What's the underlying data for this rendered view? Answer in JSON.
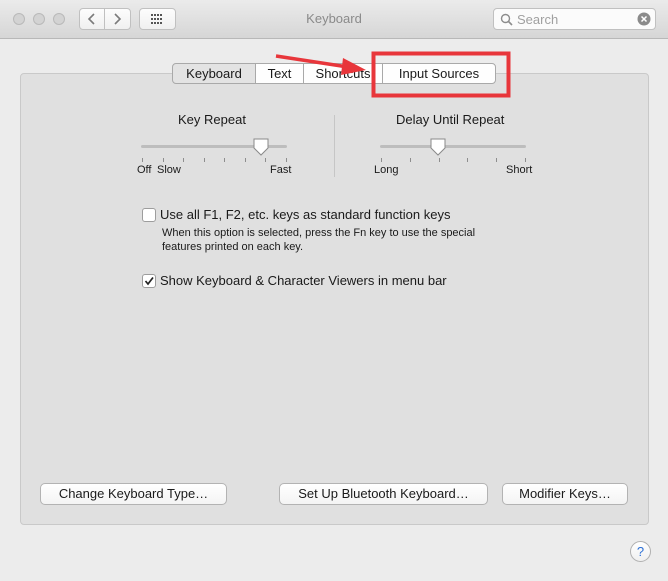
{
  "window": {
    "title": "Keyboard"
  },
  "toolbar": {
    "back": "‹",
    "forward": "›",
    "search_placeholder": "Search"
  },
  "tabs": [
    {
      "label": "Keyboard",
      "selected": true
    },
    {
      "label": "Text",
      "selected": false
    },
    {
      "label": "Shortcuts",
      "selected": false
    },
    {
      "label": "Input Sources",
      "selected": false
    }
  ],
  "sliders": {
    "key_repeat": {
      "title": "Key Repeat",
      "min_label": "Off",
      "low_label": "Slow",
      "high_label": "Fast",
      "value": 0.82
    },
    "delay": {
      "title": "Delay Until Repeat",
      "low_label": "Long",
      "high_label": "Short",
      "value": 0.4
    }
  },
  "options": {
    "fn_keys": {
      "label": "Use all F1, F2, etc. keys as standard function keys",
      "checked": false,
      "desc_line1": "When this option is selected, press the Fn key to use the special",
      "desc_line2": "features printed on each key."
    },
    "viewers": {
      "label": "Show Keyboard & Character Viewers in menu bar",
      "checked": true
    }
  },
  "buttons": {
    "change_type": "Change Keyboard Type…",
    "bluetooth": "Set Up Bluetooth Keyboard…",
    "modifier": "Modifier Keys…"
  },
  "help": "?",
  "annotation_color": "#e8363b"
}
